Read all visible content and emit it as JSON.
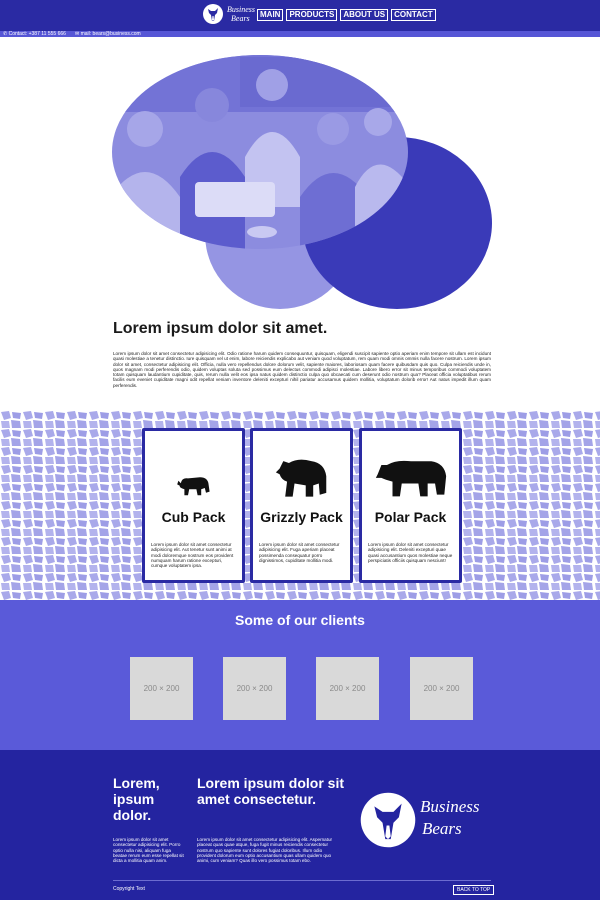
{
  "brand": {
    "line1": "Business",
    "line2": "Bears"
  },
  "nav": {
    "items": [
      "MAIN",
      "PRODUCTS",
      "ABOUT US",
      "CONTACT"
    ]
  },
  "contact": {
    "phone": "Contact: +387 11 555 666",
    "email": "mail: bears@business.com"
  },
  "intro": {
    "title": "Lorem ipsum dolor sit amet.",
    "text": "Lorem ipsum dolor sit amet consectetur adipisicing elit. Odio ratione harum quidem consequuntur, quisquam, eligendi suscipit sapiente optio aperiam enim tempore sit ullam est incidunt quasi molestiae a tenetur distinctio. Iure quisquam vel ut enim, labore reiciendis explicabo aut veniam quod voluptatum, rem quam modi omnis ommis nulla facere nostrum. Lorem ipsum dolor sit amet, consectetur adipisicing elit. Officia, nulla vero repellendus dolore dolorum velit, sapiente maiores, laboriosam quam facere quibusdam quis quo. Culpa reiciendis unde in, quos magnam modi perferendis odio, quidem voluptas soluta sed possimus eum delectus commodi adipisci molestiae. Labore libero error sit minus temporibus commodi voluptatem totam quisquam laudantium cupiditate, quis, rerum nulla velit eos ipsa natus quidem distinctio culpa quo obcaecati cum deserunt odio nostrum qua? Placeat officia voluptatibus rerum facilis eum eveniet cupiditate magni odit repellat veniam inventore deleniti excepturi nihil pariatur accusamus quidem mollitia, voluptatum dolorib error! Aut natus impedit illum quam perferendis."
  },
  "packs": [
    {
      "title": "Cub Pack",
      "text": "Lorem ipsum dolor sit amet consectetur adipisicing elit. Aut tenetur sunt animi at modi doloremque nostrum eos provident numquam harum ratione excepturi, cumque voluptatem ipsa."
    },
    {
      "title": "Grizzly Pack",
      "text": "Lorem ipsum dolor sit amet consectetur adipisicing elit. Fuga aperiam placeat possimenda consequatur porro dignissimos, cupiditate mollitia modi."
    },
    {
      "title": "Polar Pack",
      "text": "Lorem ipsum dolor sit amet consectetur adipisicing elit. Deleniti excepturi quae quasi accusantium quos molestiae neque perspiciatis officiis quisquam nesciunt!"
    }
  ],
  "clients": {
    "title": "Some of our clients",
    "logos": [
      "200 × 200",
      "200 × 200",
      "200 × 200",
      "200 × 200"
    ]
  },
  "footer": {
    "col1_title": "Lorem, ipsum dolor.",
    "col1_text": "Lorem ipsum dolor sit amet consectetur adipisicing elit. Porro optio nulla nisi, aliquam fuga beatae rerum eum esse repellat sit dicta a mollitia quam anim.",
    "col2_title": "Lorem ipsum dolor sit amet consectetur.",
    "col2_text": "Lorem ipsum dolor sit amet consectetur adipisicing elit. Aspernatur placeat quas quae atque, fuga fugit minus reiciendis consectetur nostrum quo sapiente sunt dolores fugiat doloribus. Illum odio provident dolorum eum optio accusantium quas ullam quidem quo animi, cum veniam? Quas illo vero possimus totam ebo.",
    "copyright": "Copyright Text",
    "back_to_top": "BACK TO TOP"
  },
  "colors": {
    "primary": "#2a2aa3",
    "accent": "#5a5ad9",
    "light": "#a9a9ea"
  }
}
